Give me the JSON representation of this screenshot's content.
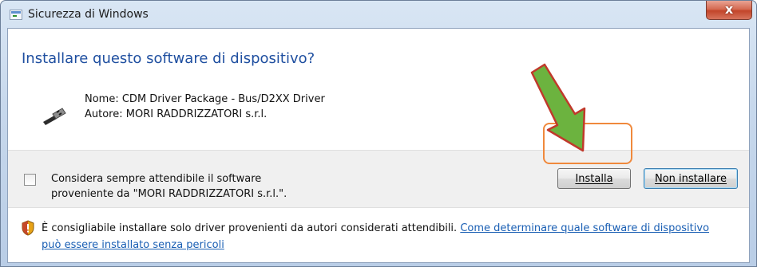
{
  "window": {
    "title": "Sicurezza di Windows",
    "close_label": "x"
  },
  "dialog": {
    "heading": "Installare questo software di dispositivo?",
    "name_line": "Nome: CDM Driver Package - Bus/D2XX Driver",
    "publisher_line": "Autore: MORI RADDRIZZATORI s.r.l."
  },
  "trust": {
    "checkbox_line1": "Considera sempre attendibile il software",
    "checkbox_line2": "proveniente da \"MORI RADDRIZZATORI s.r.l.\".",
    "checked": false
  },
  "buttons": {
    "install": "Installa",
    "skip": "Non installare"
  },
  "footer": {
    "warning_text": "È consigliabile installare solo driver provenienti da autori considerati attendibili.",
    "link_text": "Come determinare quale software di dispositivo può essere installato senza pericoli"
  },
  "icons": {
    "title": "window-security-icon",
    "driver": "usb-plug-icon",
    "warning": "shield-warning-icon",
    "annotation": "green-arrow-icon"
  },
  "colors": {
    "heading": "#1f4fa0",
    "link": "#1a5fb4",
    "highlight": "#f0893c",
    "arrow": "#6cb33f"
  }
}
